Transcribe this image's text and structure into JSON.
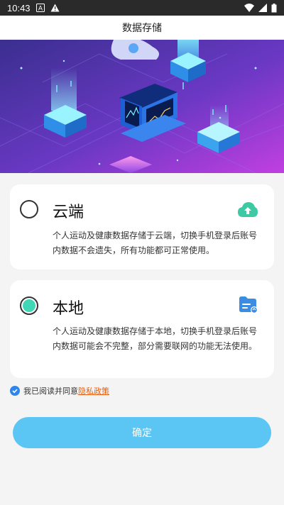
{
  "status_bar": {
    "time": "10:43",
    "icons": [
      "a-box-icon",
      "warning-icon",
      "wifi-icon",
      "cellular-icon",
      "battery-icon"
    ]
  },
  "header": {
    "title": "数据存储"
  },
  "banner": {
    "theme": "cloud-data-illustration"
  },
  "options": [
    {
      "id": "cloud",
      "title": "云端",
      "description": "个人运动及健康数据存储于云端，切换手机登录后账号内数据不会遗失，所有功能都可正常使用。",
      "selected": false,
      "icon": "cloud-upload-icon"
    },
    {
      "id": "local",
      "title": "本地",
      "description": "个人运动及健康数据存储于本地，切换手机登录后账号内数据可能会不完整，部分需要联网的功能无法使用。",
      "selected": true,
      "icon": "local-folder-icon"
    }
  ],
  "agreement": {
    "checked": true,
    "text": "我已阅读并同意",
    "link": "隐私政策"
  },
  "confirm_button": {
    "label": "确定"
  },
  "colors": {
    "radio_selected": "#3fd7b6",
    "confirm": "#5bc6f4",
    "link": "#e8600f",
    "checkbox": "#2f86e8",
    "icon_green": "#3cc9a4",
    "icon_blue": "#3b8de3"
  }
}
